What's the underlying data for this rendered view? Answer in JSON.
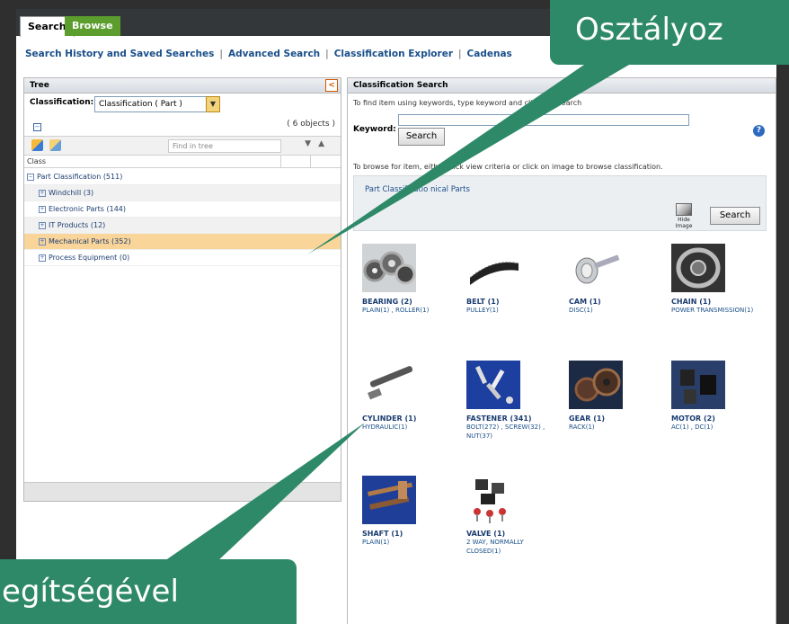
{
  "tabs": [
    {
      "label": "Search"
    },
    {
      "label": "Browse"
    }
  ],
  "links": [
    "Search History and Saved Searches",
    "Advanced Search",
    "Classification Explorer",
    "Cadenas"
  ],
  "tree": {
    "title": "Tree",
    "collapse_glyph": "<",
    "classification_label": "Classification:",
    "classification_value": "Classification ( Part )",
    "objects_count": "( 6 objects )",
    "find_placeholder": "Find in tree",
    "column_header": "Class",
    "rows": [
      {
        "label": "Part Classification (511)"
      },
      {
        "label": "Windchill (3)"
      },
      {
        "label": "Electronic Parts (144)"
      },
      {
        "label": "IT Products (12)"
      },
      {
        "label": "Mechanical Parts (352)",
        "selected": true
      },
      {
        "label": "Process Equipment (0)"
      }
    ]
  },
  "classification_search": {
    "title": "Classification Search",
    "hint": "To find item using keywords, type keyword and click the Search",
    "keyword_label": "Keyword:",
    "keyword_value": "",
    "search_label": "Search",
    "help_glyph": "?",
    "browse_hint": "To browse for item, either click                              view criteria or click on image to browse classification.",
    "breadcrumb": "Part Classificatio                     nical Parts",
    "hide_image_label": "Hide Image",
    "items": [
      {
        "name": "BEARING",
        "count": "(2)",
        "sub": "PLAIN(1) , ROLLER(1)",
        "icon": "bearing-image"
      },
      {
        "name": "BELT",
        "count": "(1)",
        "sub": "PULLEY(1)",
        "icon": "belt-image"
      },
      {
        "name": "CAM",
        "count": "(1)",
        "sub": "DISC(1)",
        "icon": "cam-image"
      },
      {
        "name": "CHAIN",
        "count": "(1)",
        "sub": "POWER TRANSMISSION(1)",
        "icon": "chain-image"
      },
      {
        "name": "CYLINDER",
        "count": "(1)",
        "sub": "HYDRAULIC(1)",
        "icon": "cylinder-image"
      },
      {
        "name": "FASTENER",
        "count": "(341)",
        "sub": "BOLT(272) , SCREW(32) , NUT(37)",
        "icon": "fastener-image"
      },
      {
        "name": "GEAR",
        "count": "(1)",
        "sub": "RACK(1)",
        "icon": "gear-image"
      },
      {
        "name": "MOTOR",
        "count": "(2)",
        "sub": "AC(1) , DC(1)",
        "icon": "motor-image"
      },
      {
        "name": "SHAFT",
        "count": "(1)",
        "sub": "PLAIN(1)",
        "icon": "shaft-image"
      },
      {
        "name": "VALVE",
        "count": "(1)",
        "sub": "2 WAY, NORMALLY CLOSED(1)",
        "icon": "valve-image"
      }
    ]
  },
  "callouts": {
    "top": "Osztályoz",
    "bottom": "egítségével"
  },
  "colors": {
    "callout": "#2e8968",
    "browse_tab": "#5c9e2e",
    "selected_row": "#f9d59a",
    "link": "#1a4f8a"
  }
}
